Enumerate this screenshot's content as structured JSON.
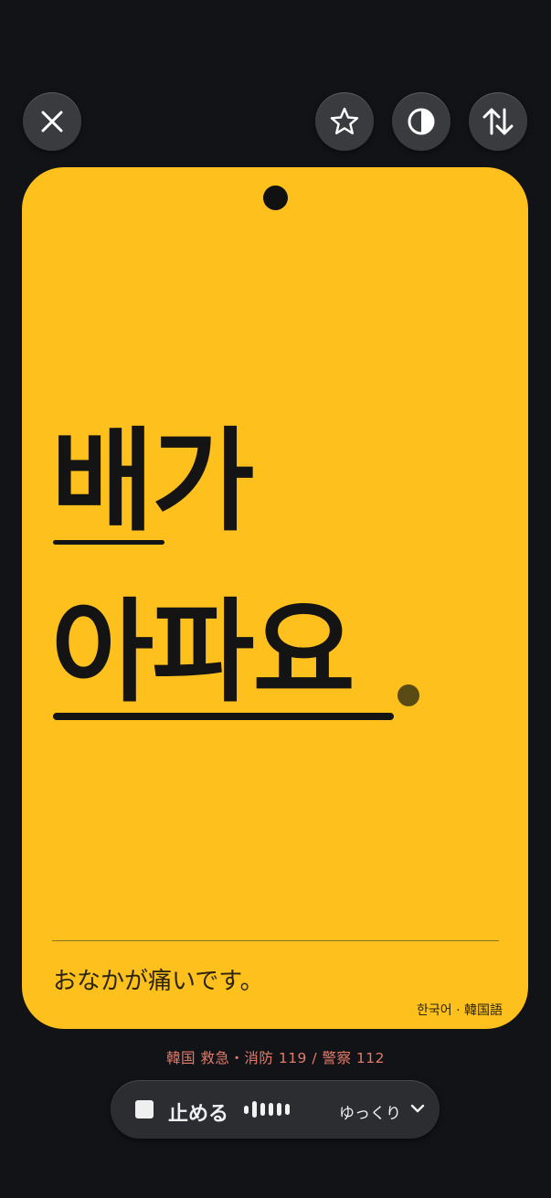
{
  "toolbar": {
    "close_icon": "close-icon",
    "favorite_icon": "star-icon",
    "contrast_icon": "contrast-icon",
    "swap_icon": "swap-vertical-icon"
  },
  "card": {
    "color": "#fdc01c",
    "phrase_line1": "배가",
    "phrase_line2": "아파요",
    "translation": "おなかが痛いです。",
    "language_label": "한국어 · 韓国語"
  },
  "emergency": {
    "text": "韓国 救急・消防 119 / 警察 112",
    "color": "#e27b6b"
  },
  "player": {
    "stop_label": "止める",
    "speed_label": "ゆっくり",
    "stop_icon": "stop-icon",
    "waveform_icon": "waveform-icon",
    "chevron_icon": "chevron-down-icon"
  }
}
